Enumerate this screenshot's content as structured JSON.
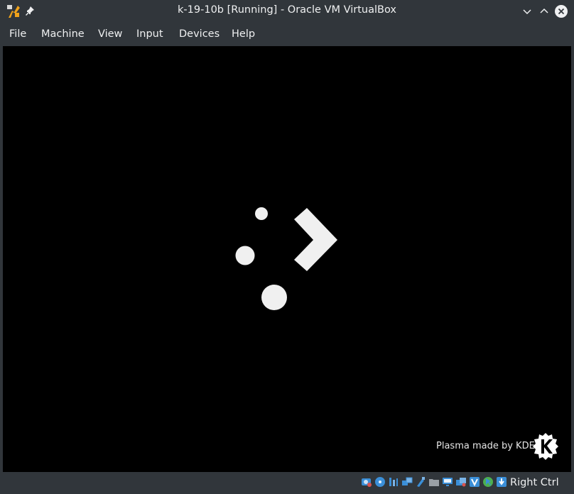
{
  "window": {
    "title": "k-19-10b [Running] - Oracle VM VirtualBox"
  },
  "menubar": {
    "items": [
      {
        "label": "File"
      },
      {
        "label": "Machine"
      },
      {
        "label": "View"
      },
      {
        "label": "Input"
      },
      {
        "label": "Devices"
      },
      {
        "label": "Help"
      }
    ]
  },
  "vm_screen": {
    "credit_text": "Plasma made by KDE"
  },
  "statusbar": {
    "indicators": [
      "hard-disk-icon",
      "optical-drive-icon",
      "audio-icon",
      "network-icon",
      "usb-icon",
      "shared-folders-icon",
      "display-icon",
      "recording-icon",
      "cpu-virtualization-icon",
      "mouse-integration-icon",
      "keyboard-capture-icon"
    ],
    "host_key": "Right Ctrl"
  },
  "colors": {
    "chrome_bg": "#31363b",
    "chrome_text": "#eff0f1",
    "vm_bg": "#000000",
    "splash_shapes": "#f0f0f0",
    "vbox_blue": "#3b8fd8"
  }
}
